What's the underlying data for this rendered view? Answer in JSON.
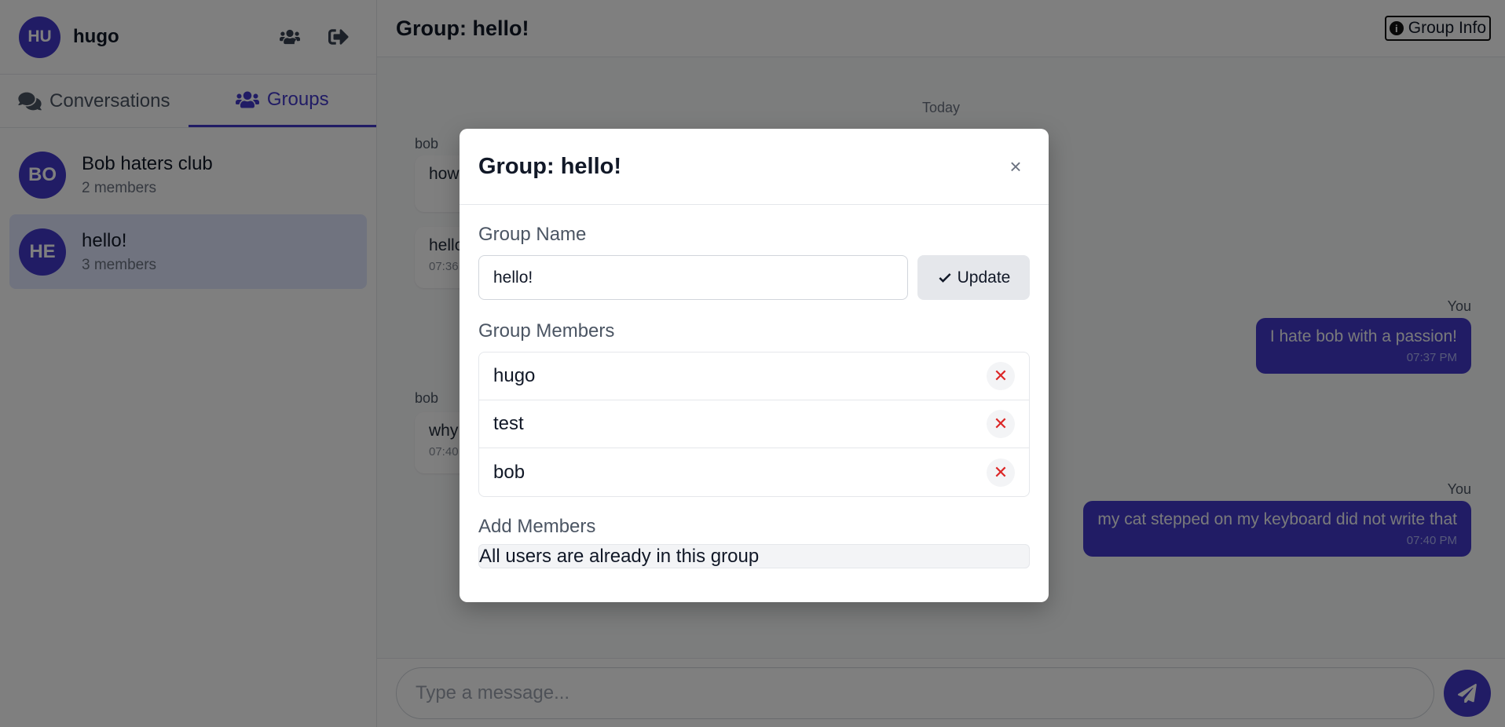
{
  "user": {
    "initials": "HU",
    "name": "hugo"
  },
  "tabs": [
    {
      "label": "Conversations",
      "active": false
    },
    {
      "label": "Groups",
      "active": true
    }
  ],
  "groups": [
    {
      "initials": "BO",
      "name": "Bob haters club",
      "members": "2 members",
      "active": false
    },
    {
      "initials": "HE",
      "name": "hello!",
      "members": "3 members",
      "active": true
    }
  ],
  "header": {
    "title": "Group: hello!",
    "info_button": "Group Info"
  },
  "messages": {
    "day_label": "Today",
    "items": [
      {
        "sender": "bob",
        "text": "how",
        "time": "",
        "direction": "in"
      },
      {
        "sender": "",
        "text": "hello",
        "time": "07:36",
        "direction": "in"
      },
      {
        "sender": "You",
        "text": "I hate bob with a passion!",
        "time": "07:37 PM",
        "direction": "out"
      },
      {
        "sender": "bob",
        "text": "why",
        "time": "07:40",
        "direction": "in"
      },
      {
        "sender": "You",
        "text": "my cat stepped on my keyboard did not write that",
        "time": "07:40 PM",
        "direction": "out"
      }
    ]
  },
  "composer": {
    "placeholder": "Type a message..."
  },
  "modal": {
    "title": "Group: hello!",
    "close": "×",
    "name_label": "Group Name",
    "name_value": "hello!",
    "update_label": "Update",
    "members_label": "Group Members",
    "members": [
      "hugo",
      "test",
      "bob"
    ],
    "remove_symbol": "✕",
    "add_label": "Add Members",
    "add_note": "All users are already in this group"
  },
  "colors": {
    "accent": "#4338ca",
    "danger": "#dc2626"
  },
  "icons": {
    "header": [
      "user-group-settings-icon",
      "logout-icon"
    ],
    "tabs": [
      "comments-icon",
      "users-icon"
    ],
    "info": "info-icon",
    "send": "send-icon",
    "update": "check-icon"
  }
}
